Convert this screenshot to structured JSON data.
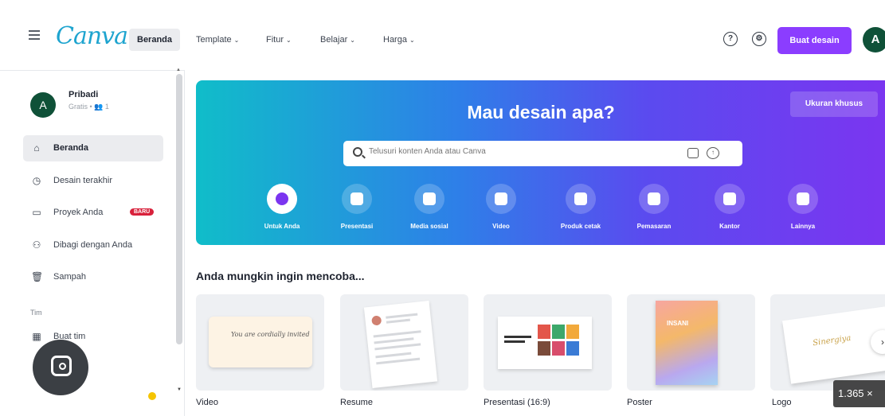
{
  "header": {
    "logo": "Canva",
    "nav": [
      {
        "label": "Beranda",
        "chevron": false
      },
      {
        "label": "Template",
        "chevron": true
      },
      {
        "label": "Fitur",
        "chevron": true
      },
      {
        "label": "Belajar",
        "chevron": true
      },
      {
        "label": "Harga",
        "chevron": true
      }
    ],
    "help_icon": "?",
    "create_button": "Buat desain",
    "avatar_letter": "A",
    "chevron": "⌄"
  },
  "sidebar": {
    "profile": {
      "letter": "A",
      "name": "Pribadi",
      "plan": "Gratis • 👥 1"
    },
    "items": [
      {
        "label": "Beranda",
        "icon": "home-icon",
        "glyph": "⌂"
      },
      {
        "label": "Desain terakhir",
        "icon": "clock-icon",
        "glyph": "◷"
      },
      {
        "label": "Proyek Anda",
        "icon": "folder-icon",
        "glyph": "▭",
        "badge": "BARU"
      },
      {
        "label": "Dibagi dengan Anda",
        "icon": "shared-icon",
        "glyph": "⚇"
      },
      {
        "label": "Sampah",
        "icon": "trash-icon",
        "glyph": "🗑"
      }
    ],
    "section_label": "Tim",
    "team_item": "Buat tim"
  },
  "hero": {
    "title": "Mau desain apa?",
    "custom_size": "Ukuran khusus",
    "search_placeholder": "Telusuri konten Anda atau Canva",
    "categories": [
      {
        "label": "Untuk Anda",
        "icon": "sparkle-icon"
      },
      {
        "label": "Presentasi",
        "icon": "presentation-icon"
      },
      {
        "label": "Media sosial",
        "icon": "heart-icon"
      },
      {
        "label": "Video",
        "icon": "video-icon"
      },
      {
        "label": "Produk cetak",
        "icon": "print-icon"
      },
      {
        "label": "Pemasaran",
        "icon": "megaphone-icon"
      },
      {
        "label": "Kantor",
        "icon": "briefcase-icon"
      },
      {
        "label": "Lainnya",
        "icon": "more-icon"
      }
    ]
  },
  "suggestions": {
    "title": "Anda mungkin ingin mencoba...",
    "cards": [
      {
        "label": "Video"
      },
      {
        "label": "Resume"
      },
      {
        "label": "Presentasi (16:9)"
      },
      {
        "label": "Poster"
      },
      {
        "label": "Logo"
      }
    ],
    "video_thumb_text": "You are cordially invited",
    "poster_thumb_text": "INSANI",
    "logo_thumb_text": "Sinergiya"
  },
  "overlay": {
    "zoom": "1.365 ×"
  },
  "colors": {
    "accent": "#8b3dff",
    "avatar": "#0f5138",
    "logo": "#1ea4cf",
    "badge": "#d8213b"
  }
}
